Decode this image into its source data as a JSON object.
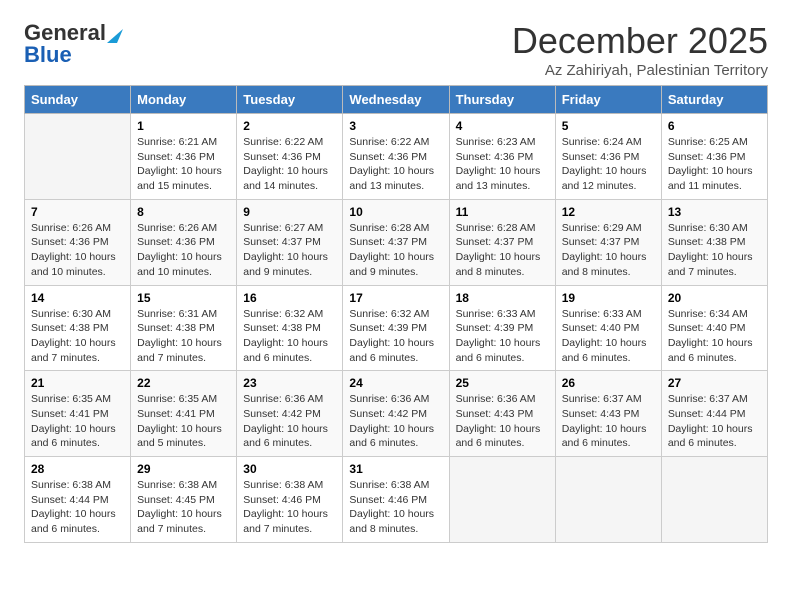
{
  "logo": {
    "general": "General",
    "blue": "Blue"
  },
  "title": "December 2025",
  "subtitle": "Az Zahiriyah, Palestinian Territory",
  "headers": [
    "Sunday",
    "Monday",
    "Tuesday",
    "Wednesday",
    "Thursday",
    "Friday",
    "Saturday"
  ],
  "weeks": [
    [
      {
        "day": "",
        "info": ""
      },
      {
        "day": "1",
        "info": "Sunrise: 6:21 AM\nSunset: 4:36 PM\nDaylight: 10 hours\nand 15 minutes."
      },
      {
        "day": "2",
        "info": "Sunrise: 6:22 AM\nSunset: 4:36 PM\nDaylight: 10 hours\nand 14 minutes."
      },
      {
        "day": "3",
        "info": "Sunrise: 6:22 AM\nSunset: 4:36 PM\nDaylight: 10 hours\nand 13 minutes."
      },
      {
        "day": "4",
        "info": "Sunrise: 6:23 AM\nSunset: 4:36 PM\nDaylight: 10 hours\nand 13 minutes."
      },
      {
        "day": "5",
        "info": "Sunrise: 6:24 AM\nSunset: 4:36 PM\nDaylight: 10 hours\nand 12 minutes."
      },
      {
        "day": "6",
        "info": "Sunrise: 6:25 AM\nSunset: 4:36 PM\nDaylight: 10 hours\nand 11 minutes."
      }
    ],
    [
      {
        "day": "7",
        "info": "Sunrise: 6:26 AM\nSunset: 4:36 PM\nDaylight: 10 hours\nand 10 minutes."
      },
      {
        "day": "8",
        "info": "Sunrise: 6:26 AM\nSunset: 4:36 PM\nDaylight: 10 hours\nand 10 minutes."
      },
      {
        "day": "9",
        "info": "Sunrise: 6:27 AM\nSunset: 4:37 PM\nDaylight: 10 hours\nand 9 minutes."
      },
      {
        "day": "10",
        "info": "Sunrise: 6:28 AM\nSunset: 4:37 PM\nDaylight: 10 hours\nand 9 minutes."
      },
      {
        "day": "11",
        "info": "Sunrise: 6:28 AM\nSunset: 4:37 PM\nDaylight: 10 hours\nand 8 minutes."
      },
      {
        "day": "12",
        "info": "Sunrise: 6:29 AM\nSunset: 4:37 PM\nDaylight: 10 hours\nand 8 minutes."
      },
      {
        "day": "13",
        "info": "Sunrise: 6:30 AM\nSunset: 4:38 PM\nDaylight: 10 hours\nand 7 minutes."
      }
    ],
    [
      {
        "day": "14",
        "info": "Sunrise: 6:30 AM\nSunset: 4:38 PM\nDaylight: 10 hours\nand 7 minutes."
      },
      {
        "day": "15",
        "info": "Sunrise: 6:31 AM\nSunset: 4:38 PM\nDaylight: 10 hours\nand 7 minutes."
      },
      {
        "day": "16",
        "info": "Sunrise: 6:32 AM\nSunset: 4:38 PM\nDaylight: 10 hours\nand 6 minutes."
      },
      {
        "day": "17",
        "info": "Sunrise: 6:32 AM\nSunset: 4:39 PM\nDaylight: 10 hours\nand 6 minutes."
      },
      {
        "day": "18",
        "info": "Sunrise: 6:33 AM\nSunset: 4:39 PM\nDaylight: 10 hours\nand 6 minutes."
      },
      {
        "day": "19",
        "info": "Sunrise: 6:33 AM\nSunset: 4:40 PM\nDaylight: 10 hours\nand 6 minutes."
      },
      {
        "day": "20",
        "info": "Sunrise: 6:34 AM\nSunset: 4:40 PM\nDaylight: 10 hours\nand 6 minutes."
      }
    ],
    [
      {
        "day": "21",
        "info": "Sunrise: 6:35 AM\nSunset: 4:41 PM\nDaylight: 10 hours\nand 6 minutes."
      },
      {
        "day": "22",
        "info": "Sunrise: 6:35 AM\nSunset: 4:41 PM\nDaylight: 10 hours\nand 5 minutes."
      },
      {
        "day": "23",
        "info": "Sunrise: 6:36 AM\nSunset: 4:42 PM\nDaylight: 10 hours\nand 6 minutes."
      },
      {
        "day": "24",
        "info": "Sunrise: 6:36 AM\nSunset: 4:42 PM\nDaylight: 10 hours\nand 6 minutes."
      },
      {
        "day": "25",
        "info": "Sunrise: 6:36 AM\nSunset: 4:43 PM\nDaylight: 10 hours\nand 6 minutes."
      },
      {
        "day": "26",
        "info": "Sunrise: 6:37 AM\nSunset: 4:43 PM\nDaylight: 10 hours\nand 6 minutes."
      },
      {
        "day": "27",
        "info": "Sunrise: 6:37 AM\nSunset: 4:44 PM\nDaylight: 10 hours\nand 6 minutes."
      }
    ],
    [
      {
        "day": "28",
        "info": "Sunrise: 6:38 AM\nSunset: 4:44 PM\nDaylight: 10 hours\nand 6 minutes."
      },
      {
        "day": "29",
        "info": "Sunrise: 6:38 AM\nSunset: 4:45 PM\nDaylight: 10 hours\nand 7 minutes."
      },
      {
        "day": "30",
        "info": "Sunrise: 6:38 AM\nSunset: 4:46 PM\nDaylight: 10 hours\nand 7 minutes."
      },
      {
        "day": "31",
        "info": "Sunrise: 6:38 AM\nSunset: 4:46 PM\nDaylight: 10 hours\nand 8 minutes."
      },
      {
        "day": "",
        "info": ""
      },
      {
        "day": "",
        "info": ""
      },
      {
        "day": "",
        "info": ""
      }
    ]
  ]
}
